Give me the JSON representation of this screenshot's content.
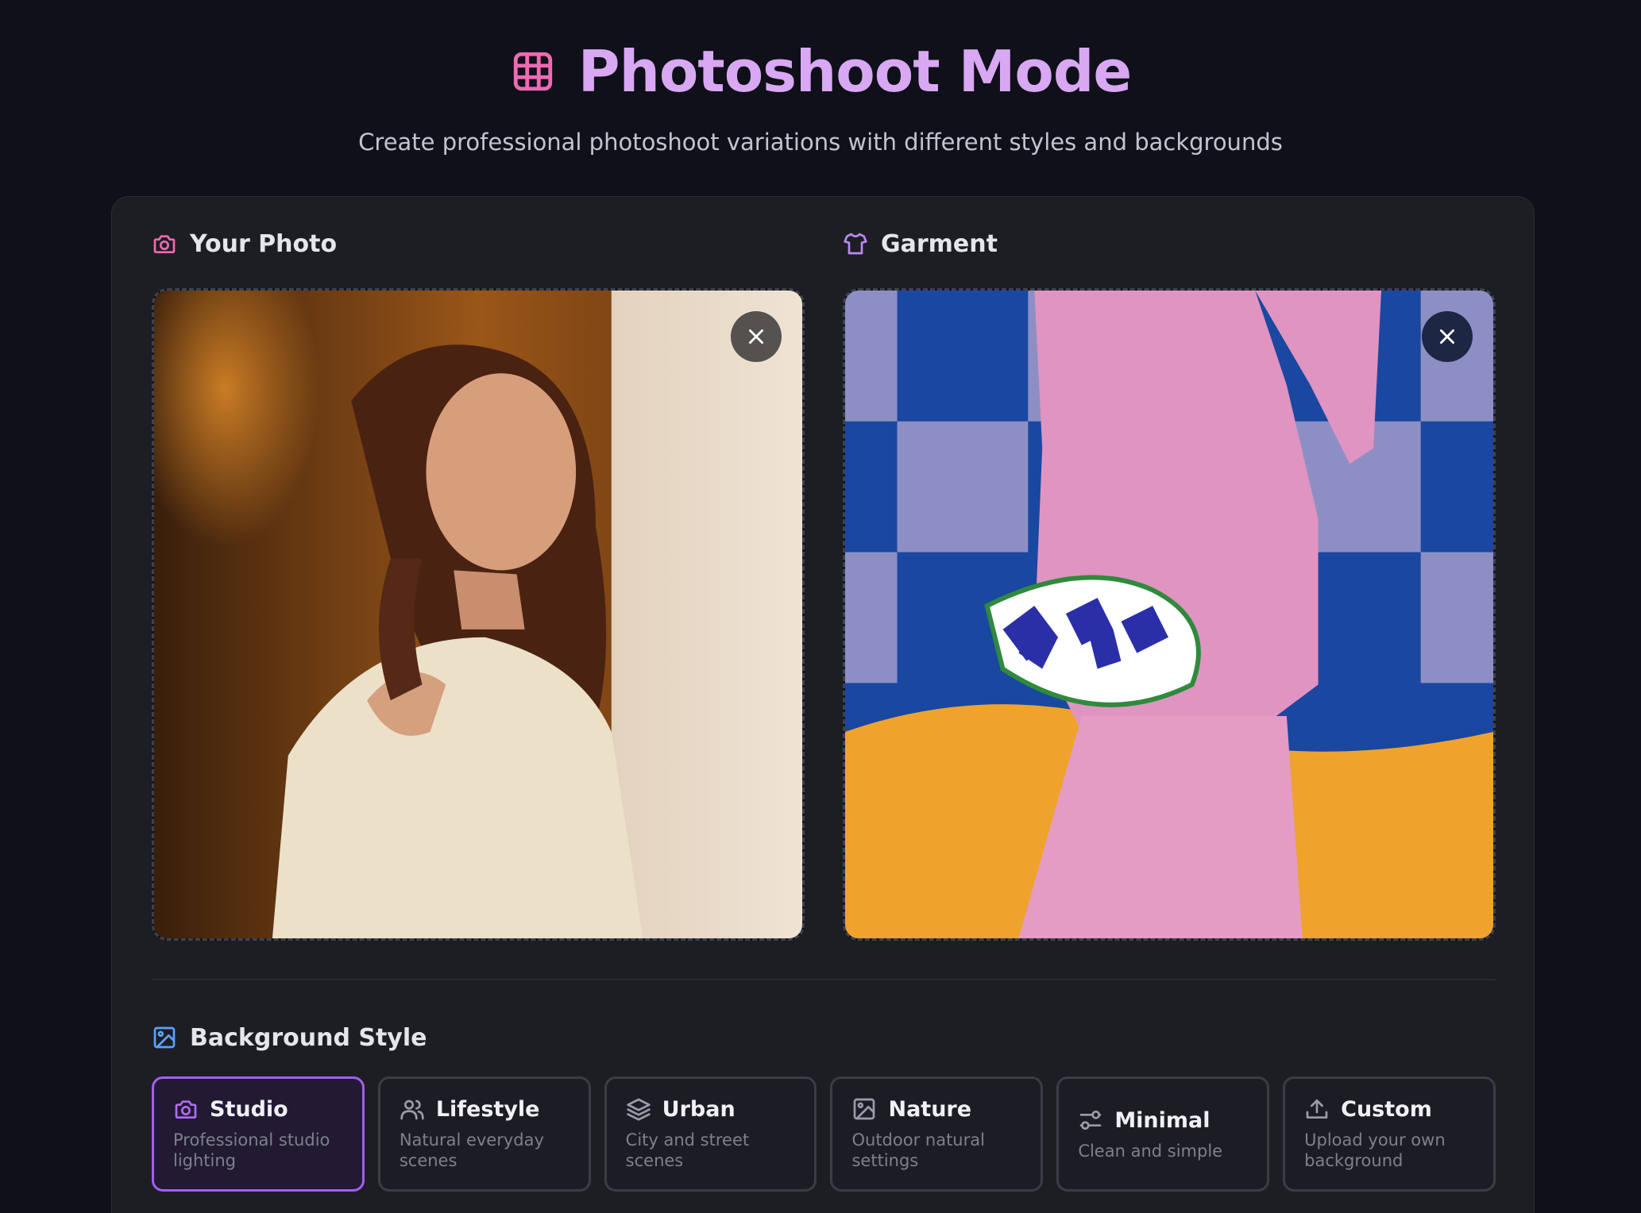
{
  "header": {
    "title": "Photoshoot Mode",
    "subtitle": "Create professional photoshoot variations with different styles and backgrounds",
    "icon": "grid-icon",
    "accent": "#d9a8f2"
  },
  "uploads": {
    "photo": {
      "label": "Your Photo",
      "icon": "camera-icon"
    },
    "garment": {
      "label": "Garment",
      "icon": "shirt-icon"
    }
  },
  "background": {
    "label": "Background Style",
    "icon": "image-icon",
    "selected": "Studio",
    "options": [
      {
        "title": "Studio",
        "desc": "Professional studio lighting",
        "icon": "camera-icon"
      },
      {
        "title": "Lifestyle",
        "desc": "Natural everyday scenes",
        "icon": "users-icon"
      },
      {
        "title": "Urban",
        "desc": "City and street scenes",
        "icon": "layers-icon"
      },
      {
        "title": "Nature",
        "desc": "Outdoor natural settings",
        "icon": "image-icon"
      },
      {
        "title": "Minimal",
        "desc": "Clean and simple",
        "icon": "sliders-icon"
      },
      {
        "title": "Custom",
        "desc": "Upload your own background",
        "icon": "upload-icon"
      }
    ]
  },
  "colors": {
    "background": "#0f1019",
    "panel": "#1d1e24",
    "selected_border": "#a45ef2"
  }
}
